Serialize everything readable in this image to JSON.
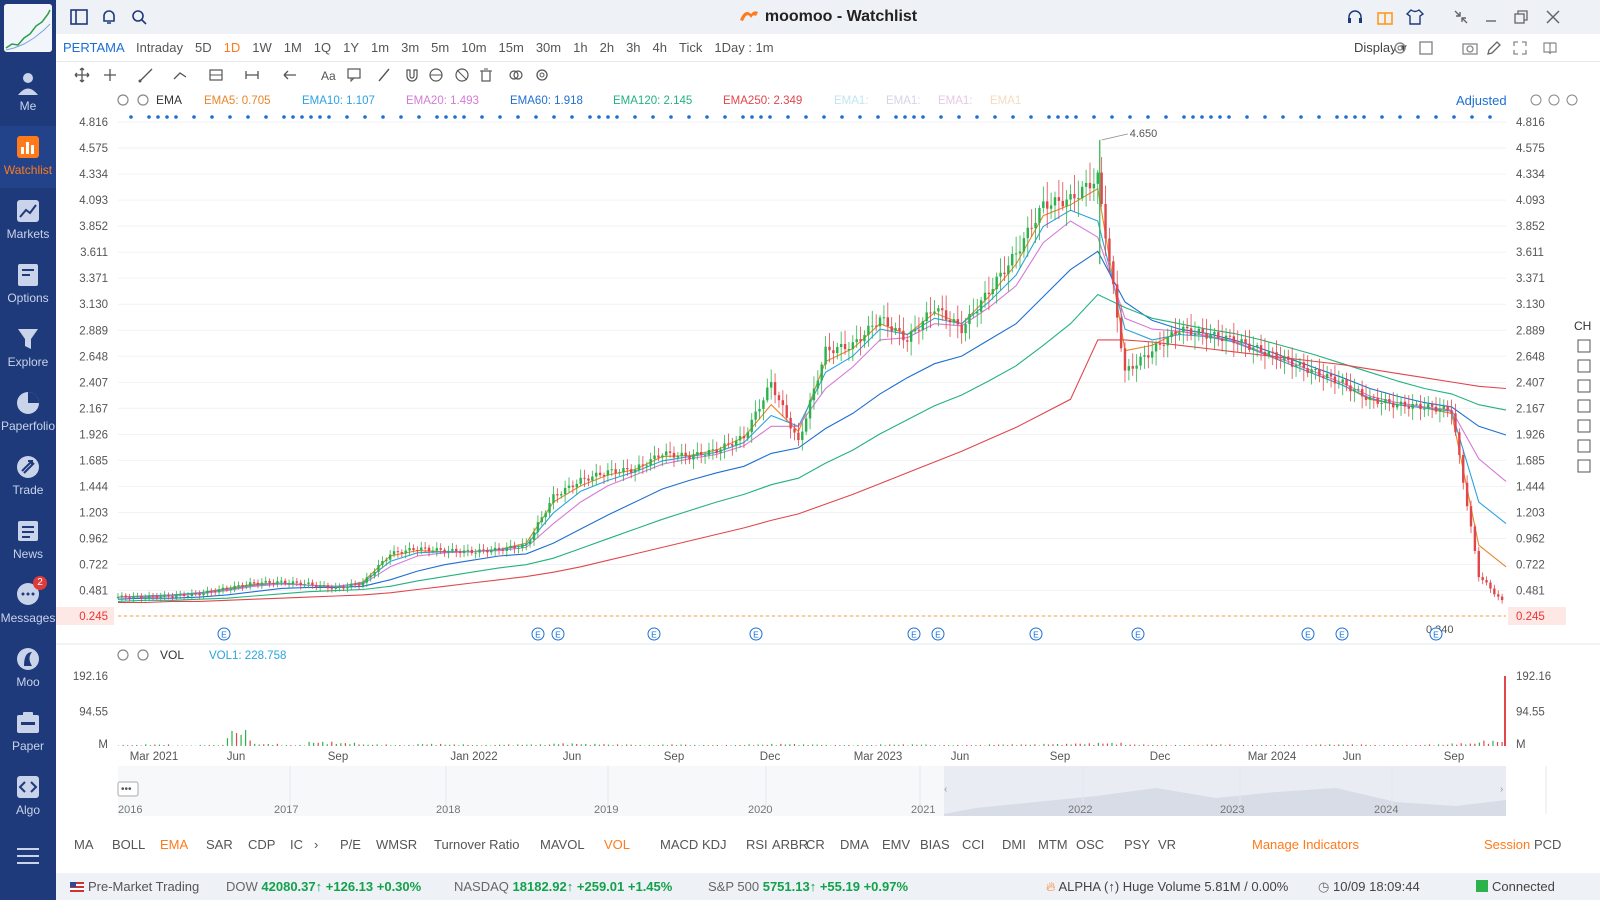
{
  "app": {
    "title": "moomoo - Watchlist"
  },
  "nav": [
    {
      "label": "Me",
      "icon": "user-icon"
    },
    {
      "label": "Watchlist",
      "icon": "bar-chart-icon",
      "active": true
    },
    {
      "label": "Markets",
      "icon": "trend-icon"
    },
    {
      "label": "Options",
      "icon": "options-icon"
    },
    {
      "label": "Explore",
      "icon": "funnel-icon"
    },
    {
      "label": "Paperfolio",
      "icon": "pie-icon"
    },
    {
      "label": "Trade",
      "icon": "trade-icon"
    },
    {
      "label": "News",
      "icon": "news-icon"
    },
    {
      "label": "Messages",
      "icon": "chat-icon",
      "badge": "2"
    },
    {
      "label": "Moo",
      "icon": "moo-icon"
    },
    {
      "label": "Paper",
      "icon": "paper-icon"
    },
    {
      "label": "Algo",
      "icon": "code-icon"
    }
  ],
  "periodbar": {
    "ticker": "PERTAMA",
    "periods": [
      "Intraday",
      "5D",
      "1D",
      "1W",
      "1M",
      "1Q",
      "1Y",
      "1m",
      "3m",
      "5m",
      "10m",
      "15m",
      "30m",
      "1h",
      "2h",
      "3h",
      "4h",
      "Tick",
      "1Day : 1m"
    ],
    "active": "1D",
    "display": "Display"
  },
  "main_indicator": {
    "name": "EMA",
    "items": [
      {
        "label": "EMA5: 0.705",
        "color": "#e8862a"
      },
      {
        "label": "EMA10: 1.107",
        "color": "#2ba3e0"
      },
      {
        "label": "EMA20: 1.493",
        "color": "#d47ad6"
      },
      {
        "label": "EMA60: 1.918",
        "color": "#1f6fd1"
      },
      {
        "label": "EMA120: 2.145",
        "color": "#23b27d"
      },
      {
        "label": "EMA250: 2.349",
        "color": "#e0474c"
      },
      {
        "label": "EMA1:",
        "color": "#bfe5f3"
      },
      {
        "label": "EMA1:",
        "color": "#d9d2e6"
      },
      {
        "label": "EMA1:",
        "color": "#e6c9e6"
      },
      {
        "label": "EMA1",
        "color": "#f3dcc2"
      }
    ],
    "adjusted": "Adjusted"
  },
  "sub_indicator": {
    "name": "VOL",
    "value": "VOL1: 228.758"
  },
  "chart_data": {
    "type": "candlestick",
    "price_axis": [
      "4.816",
      "4.575",
      "4.334",
      "4.093",
      "3.852",
      "3.611",
      "3.371",
      "3.130",
      "2.889",
      "2.648",
      "2.407",
      "2.167",
      "1.926",
      "1.685",
      "1.444",
      "1.203",
      "0.962",
      "0.722",
      "0.481",
      "0.245"
    ],
    "current_price": "0.245",
    "high_label": "4.650",
    "low_label": "0.340",
    "volume_axis": [
      "192.16",
      "94.55",
      "M"
    ],
    "time_axis": [
      "Mar 2021",
      "Jun",
      "Sep",
      "Jan 2022",
      "Jun",
      "Sep",
      "Dec",
      "Mar 2023",
      "Jun",
      "Sep",
      "Dec",
      "Mar 2024",
      "Jun",
      "Sep"
    ],
    "overview_years": [
      "2016",
      "2017",
      "2018",
      "2019",
      "2020",
      "2021",
      "2022",
      "2023",
      "2024"
    ],
    "series_close": [
      0.42,
      0.42,
      0.43,
      0.45,
      0.5,
      0.55,
      0.56,
      0.54,
      0.5,
      0.55,
      0.82,
      0.87,
      0.85,
      0.84,
      0.86,
      0.9,
      1.35,
      1.5,
      1.58,
      1.6,
      1.75,
      1.72,
      1.78,
      1.9,
      2.4,
      1.85,
      2.7,
      2.75,
      3.0,
      2.8,
      3.1,
      2.9,
      3.25,
      3.6,
      4.05,
      4.1,
      4.3,
      2.5,
      2.7,
      2.9,
      2.85,
      2.8,
      2.7,
      2.6,
      2.5,
      2.4,
      2.25,
      2.2,
      2.18,
      2.15,
      0.62,
      0.34
    ],
    "ema": [
      {
        "name": "EMA5",
        "values": [
          0.42,
          0.43,
          0.44,
          0.46,
          0.5,
          0.54,
          0.55,
          0.53,
          0.51,
          0.56,
          0.8,
          0.85,
          0.84,
          0.84,
          0.86,
          0.92,
          1.3,
          1.45,
          1.55,
          1.6,
          1.72,
          1.73,
          1.78,
          1.9,
          2.2,
          1.95,
          2.6,
          2.72,
          2.95,
          2.85,
          3.05,
          2.95,
          3.2,
          3.5,
          3.95,
          4.05,
          4.2,
          2.7,
          2.75,
          2.88,
          2.84,
          2.78,
          2.68,
          2.58,
          2.48,
          2.38,
          2.25,
          2.2,
          2.17,
          2.12,
          0.9,
          0.7
        ]
      },
      {
        "name": "EMA10",
        "values": [
          0.42,
          0.43,
          0.44,
          0.46,
          0.49,
          0.53,
          0.55,
          0.53,
          0.52,
          0.55,
          0.75,
          0.83,
          0.84,
          0.84,
          0.86,
          0.9,
          1.2,
          1.4,
          1.5,
          1.58,
          1.68,
          1.72,
          1.76,
          1.85,
          2.1,
          2.0,
          2.5,
          2.65,
          2.9,
          2.85,
          3.0,
          2.95,
          3.15,
          3.4,
          3.85,
          4.0,
          3.9,
          2.9,
          2.8,
          2.85,
          2.83,
          2.78,
          2.68,
          2.58,
          2.48,
          2.38,
          2.26,
          2.2,
          2.17,
          2.14,
          1.3,
          1.1
        ]
      },
      {
        "name": "EMA20",
        "values": [
          0.42,
          0.42,
          0.43,
          0.45,
          0.48,
          0.52,
          0.54,
          0.53,
          0.52,
          0.54,
          0.7,
          0.8,
          0.83,
          0.84,
          0.85,
          0.88,
          1.1,
          1.3,
          1.45,
          1.55,
          1.65,
          1.7,
          1.74,
          1.82,
          2.0,
          2.0,
          2.35,
          2.55,
          2.8,
          2.82,
          2.95,
          2.93,
          3.1,
          3.3,
          3.7,
          3.9,
          3.75,
          3.0,
          2.9,
          2.88,
          2.84,
          2.79,
          2.69,
          2.6,
          2.5,
          2.4,
          2.28,
          2.22,
          2.18,
          2.15,
          1.7,
          1.49
        ]
      },
      {
        "name": "EMA60",
        "values": [
          0.4,
          0.41,
          0.41,
          0.42,
          0.44,
          0.47,
          0.5,
          0.51,
          0.51,
          0.52,
          0.58,
          0.66,
          0.72,
          0.76,
          0.8,
          0.82,
          0.92,
          1.05,
          1.18,
          1.3,
          1.42,
          1.5,
          1.57,
          1.63,
          1.75,
          1.8,
          1.98,
          2.12,
          2.3,
          2.45,
          2.58,
          2.65,
          2.8,
          2.95,
          3.2,
          3.45,
          3.62,
          3.15,
          2.98,
          2.9,
          2.86,
          2.8,
          2.72,
          2.63,
          2.54,
          2.45,
          2.35,
          2.28,
          2.22,
          2.18,
          2.0,
          1.92
        ]
      },
      {
        "name": "EMA120",
        "values": [
          0.38,
          0.39,
          0.39,
          0.4,
          0.41,
          0.43,
          0.45,
          0.47,
          0.48,
          0.49,
          0.52,
          0.57,
          0.61,
          0.65,
          0.69,
          0.72,
          0.78,
          0.87,
          0.96,
          1.05,
          1.14,
          1.22,
          1.3,
          1.37,
          1.46,
          1.52,
          1.66,
          1.78,
          1.93,
          2.06,
          2.19,
          2.29,
          2.42,
          2.56,
          2.75,
          2.95,
          3.22,
          3.1,
          3.0,
          2.95,
          2.9,
          2.86,
          2.8,
          2.73,
          2.66,
          2.58,
          2.5,
          2.42,
          2.35,
          2.3,
          2.2,
          2.15
        ]
      },
      {
        "name": "EMA250",
        "values": [
          0.37,
          0.37,
          0.38,
          0.38,
          0.39,
          0.4,
          0.41,
          0.42,
          0.43,
          0.44,
          0.46,
          0.49,
          0.52,
          0.55,
          0.58,
          0.61,
          0.65,
          0.7,
          0.76,
          0.82,
          0.88,
          0.94,
          1.0,
          1.06,
          1.13,
          1.19,
          1.28,
          1.37,
          1.47,
          1.57,
          1.67,
          1.77,
          1.88,
          1.99,
          2.12,
          2.25,
          2.8,
          2.8,
          2.78,
          2.75,
          2.72,
          2.69,
          2.66,
          2.63,
          2.6,
          2.57,
          2.53,
          2.49,
          2.45,
          2.41,
          2.37,
          2.35
        ]
      }
    ],
    "volume": [
      2,
      3,
      1,
      2,
      30,
      4,
      2,
      8,
      6,
      3,
      2,
      4,
      3,
      2,
      3,
      3,
      5,
      4,
      3,
      2,
      3,
      2,
      2,
      3,
      4,
      3,
      2,
      2,
      3,
      3,
      2,
      2,
      3,
      3,
      4,
      5,
      6,
      3,
      2,
      2,
      3,
      2,
      2,
      2,
      3,
      3,
      2,
      2,
      3,
      5,
      10,
      192
    ]
  },
  "indicators": [
    "MA",
    "BOLL",
    "EMA",
    "SAR",
    "CDP",
    "IC",
    "P/E",
    "WMSR",
    "Turnover Ratio",
    "MAVOL",
    "VOL",
    "MACD",
    "KDJ",
    "RSI",
    "ARBR",
    "CR",
    "DMA",
    "EMV",
    "BIAS",
    "CCI",
    "DMI",
    "MTM",
    "OSC",
    "PSY",
    "VR",
    "Manage Indicators",
    "Session",
    "PCD"
  ],
  "status": {
    "session": "Pre-Market Trading",
    "dow": {
      "name": "DOW",
      "price": "42080.37↑",
      "change": "+126.13",
      "pct": "+0.30%"
    },
    "nasdaq": {
      "name": "NASDAQ",
      "price": "18182.92↑",
      "change": "+259.01",
      "pct": "+1.45%"
    },
    "sp500": {
      "name": "S&P 500",
      "price": "5751.13↑",
      "change": "+55.19",
      "pct": "+0.97%"
    },
    "alpha": "ALPHA",
    "alert": "(↑) Huge Volume 5.81M / 0.00%",
    "time": "10/09 18:09:44",
    "connection": "Connected"
  },
  "right_tools": [
    "CH"
  ],
  "event_marker": "E"
}
